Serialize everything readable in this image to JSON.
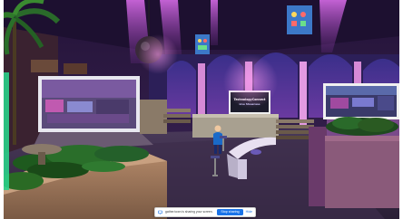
{
  "sharing_bar": {
    "message": "gather.town is sharing your screen.",
    "stop_label": "Stop sharing",
    "hide_label": "Hide"
  },
  "venue": {
    "center_screen_title": "TechnologyConnect",
    "center_screen_subtitle": "Live Showcase"
  },
  "colors": {
    "ceiling": "#2a1740",
    "accent_magenta": "#c050d8",
    "wall_blue": "#3a3a8a",
    "floor": "#3a2a48",
    "stop_button": "#1a73e8"
  }
}
